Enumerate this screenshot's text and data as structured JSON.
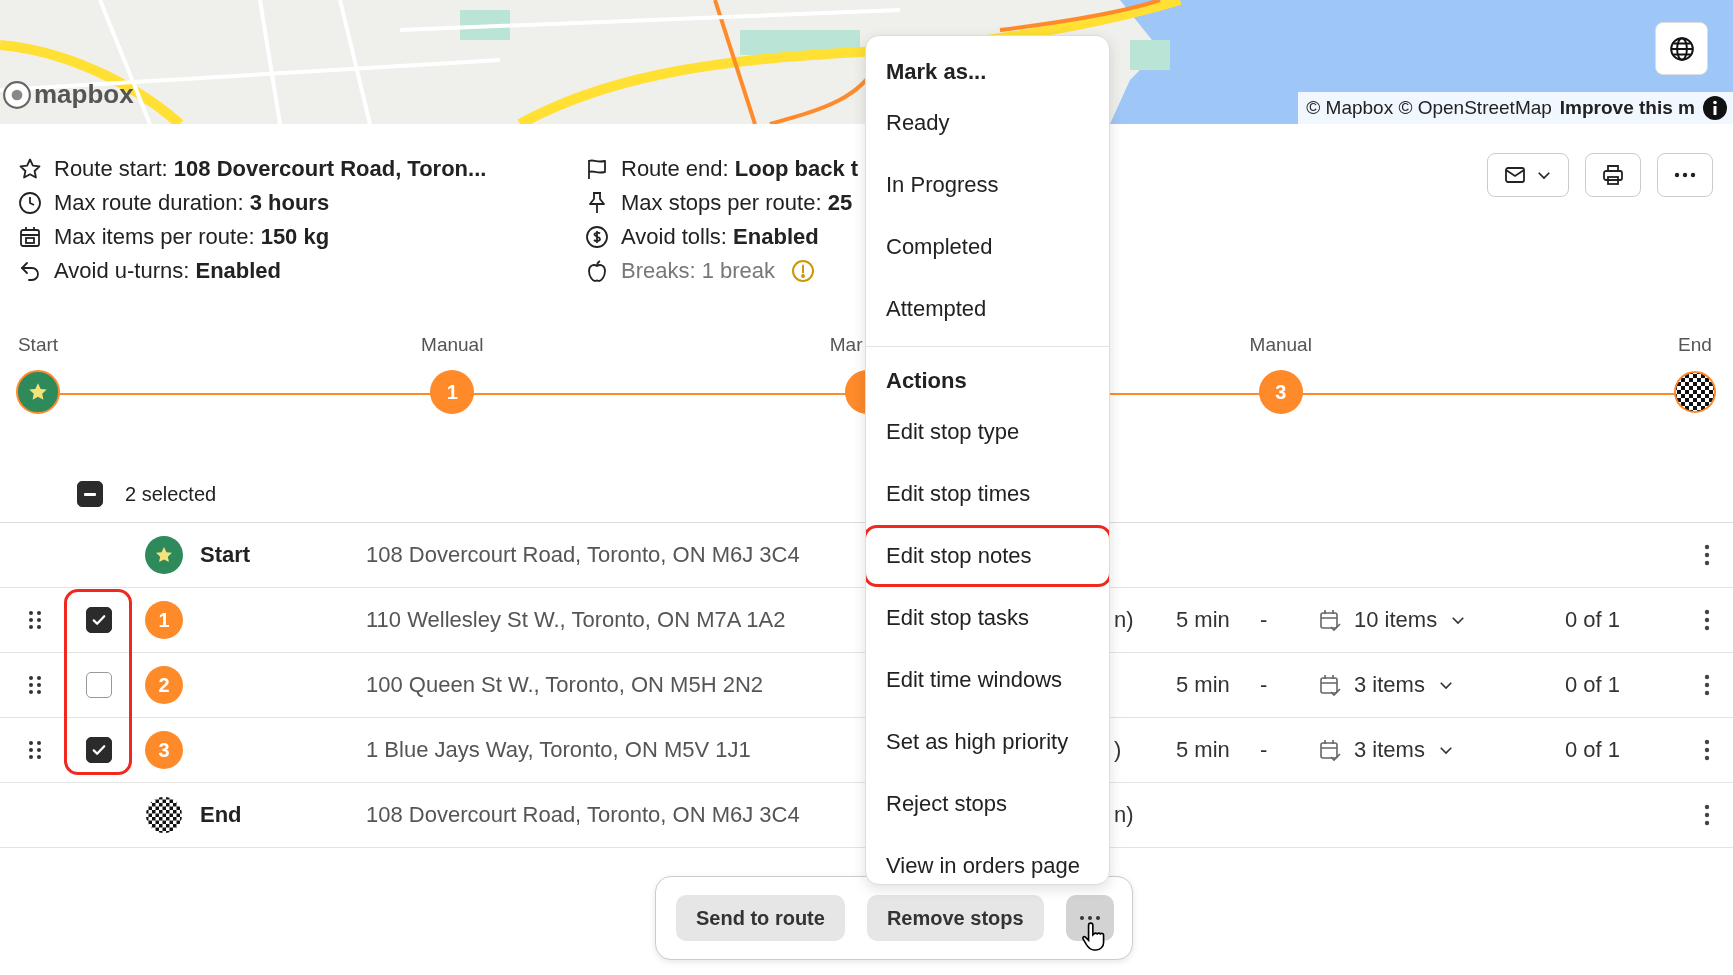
{
  "map": {
    "logo": "mapbox",
    "attribution": "© Mapbox © OpenStreetMap",
    "improve_link": "Improve this m"
  },
  "route_info": [
    [
      {
        "kind": "start",
        "label": "Route start:",
        "value": "108 Dovercourt Road, Toron..."
      },
      {
        "kind": "duration",
        "label": "Max route duration:",
        "value": "3 hours"
      },
      {
        "kind": "capacity",
        "label": "Max items per route:",
        "value": "150 kg"
      },
      {
        "kind": "uturns",
        "label": "Avoid u-turns:",
        "value": "Enabled"
      }
    ],
    [
      {
        "kind": "end",
        "label": "Route end:",
        "value": "Loop back t"
      },
      {
        "kind": "stops",
        "label": "Max stops per route:",
        "value": "25"
      },
      {
        "kind": "tolls",
        "label": "Avoid tolls:",
        "value": "Enabled"
      },
      {
        "kind": "breaks",
        "label": "Breaks: 1 break"
      }
    ]
  ],
  "toolbar": [
    {
      "kind": "email"
    },
    {
      "kind": "print"
    },
    {
      "kind": "more"
    }
  ],
  "timeline": [
    {
      "label": "Start",
      "kind": "start"
    },
    {
      "label": "Manual",
      "kind": "stop",
      "number": "1"
    },
    {
      "label": "Mar",
      "kind": "partial"
    },
    {
      "label": "Manual",
      "kind": "stop",
      "number": "3"
    },
    {
      "label": "End",
      "kind": "end"
    }
  ],
  "selection": {
    "label": "2 selected",
    "indeterminate": true
  },
  "table": {
    "checkbox_outline": true,
    "rows": [
      {
        "kind": "start",
        "name": "Start",
        "address": "108 Dovercourt Road, Toronto, ON M6J 3C4"
      },
      {
        "kind": "stop",
        "number": "1",
        "checked": true,
        "address": "110 Wellesley St W., Toronto, ON M7A 1A2",
        "column_5": "n)",
        "duration": "5 min",
        "column_7": "-",
        "items": "10 items",
        "progress": "0 of 1"
      },
      {
        "kind": "stop",
        "number": "2",
        "checked": false,
        "address": "100 Queen St W., Toronto, ON M5H 2N2",
        "duration": "5 min",
        "column_7": "-",
        "items": "3 items",
        "progress": "0 of 1"
      },
      {
        "kind": "stop",
        "number": "3",
        "checked": true,
        "address": "1 Blue Jays Way, Toronto, ON M5V 1J1",
        "column_5": ")",
        "duration": "5 min",
        "column_7": "-",
        "items": "3 items",
        "progress": "0 of 1"
      },
      {
        "kind": "end",
        "name": "End",
        "address": "108 Dovercourt Road, Toronto, ON M6J 3C4",
        "column_5": "n)"
      }
    ]
  },
  "menu": {
    "sections": [
      {
        "heading": "Mark as...",
        "items": [
          {
            "label": "Ready",
            "highlighted": false
          },
          {
            "label": "In Progress",
            "highlighted": false
          },
          {
            "label": "Completed",
            "highlighted": false
          },
          {
            "label": "Attempted",
            "highlighted": false
          }
        ]
      },
      {
        "heading": "Actions",
        "items": [
          {
            "label": "Edit stop type",
            "highlighted": false
          },
          {
            "label": "Edit stop times",
            "highlighted": false
          },
          {
            "label": "Edit stop notes",
            "highlighted": true
          },
          {
            "label": "Edit stop tasks",
            "highlighted": false
          },
          {
            "label": "Edit time windows",
            "highlighted": false
          },
          {
            "label": "Set as high priority",
            "highlighted": false
          },
          {
            "label": "Reject stops",
            "highlighted": false
          },
          {
            "label": "View in orders page",
            "highlighted": false
          }
        ]
      }
    ]
  },
  "action_bar": [
    {
      "kind": "text",
      "label": "Send to route",
      "hovered": false
    },
    {
      "kind": "text",
      "label": "Remove stops",
      "hovered": false
    },
    {
      "kind": "more",
      "hovered": true
    }
  ]
}
